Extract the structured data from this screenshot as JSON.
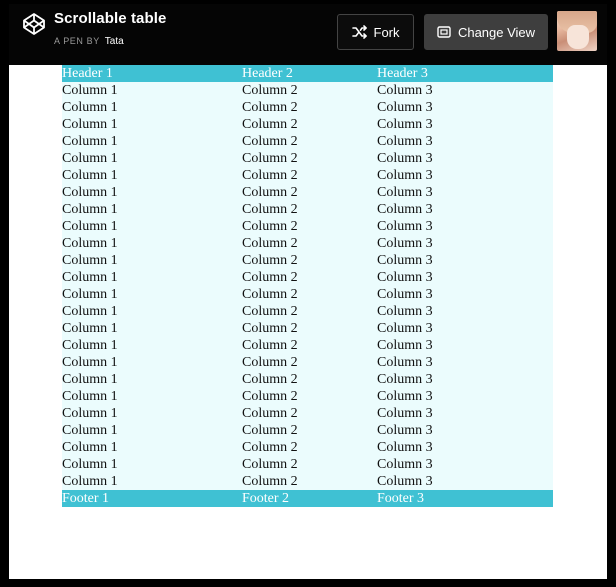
{
  "header": {
    "title": "Scrollable table",
    "byline_prefix": "A PEN BY",
    "author": "Tata",
    "fork_label": "Fork",
    "change_view_label": "Change View"
  },
  "table": {
    "headers": [
      "Header 1",
      "Header 2",
      "Header 3"
    ],
    "rows": [
      [
        "Column 1",
        "Column 2",
        "Column 3"
      ],
      [
        "Column 1",
        "Column 2",
        "Column 3"
      ],
      [
        "Column 1",
        "Column 2",
        "Column 3"
      ],
      [
        "Column 1",
        "Column 2",
        "Column 3"
      ],
      [
        "Column 1",
        "Column 2",
        "Column 3"
      ],
      [
        "Column 1",
        "Column 2",
        "Column 3"
      ],
      [
        "Column 1",
        "Column 2",
        "Column 3"
      ],
      [
        "Column 1",
        "Column 2",
        "Column 3"
      ],
      [
        "Column 1",
        "Column 2",
        "Column 3"
      ],
      [
        "Column 1",
        "Column 2",
        "Column 3"
      ],
      [
        "Column 1",
        "Column 2",
        "Column 3"
      ],
      [
        "Column 1",
        "Column 2",
        "Column 3"
      ],
      [
        "Column 1",
        "Column 2",
        "Column 3"
      ],
      [
        "Column 1",
        "Column 2",
        "Column 3"
      ],
      [
        "Column 1",
        "Column 2",
        "Column 3"
      ],
      [
        "Column 1",
        "Column 2",
        "Column 3"
      ],
      [
        "Column 1",
        "Column 2",
        "Column 3"
      ],
      [
        "Column 1",
        "Column 2",
        "Column 3"
      ],
      [
        "Column 1",
        "Column 2",
        "Column 3"
      ],
      [
        "Column 1",
        "Column 2",
        "Column 3"
      ],
      [
        "Column 1",
        "Column 2",
        "Column 3"
      ],
      [
        "Column 1",
        "Column 2",
        "Column 3"
      ],
      [
        "Column 1",
        "Column 2",
        "Column 3"
      ],
      [
        "Column 1",
        "Column 2",
        "Column 3"
      ]
    ],
    "footers": [
      "Footer 1",
      "Footer 2",
      "Footer 3"
    ]
  },
  "icons": {
    "logo": "codepen-logo-icon",
    "fork": "fork-icon",
    "change_view": "change-view-icon"
  },
  "colors": {
    "accent": "#3fc1d3",
    "row_background": "#ebfcfd",
    "header_bar": "#050505",
    "change_view_button": "#3e3e3e"
  }
}
